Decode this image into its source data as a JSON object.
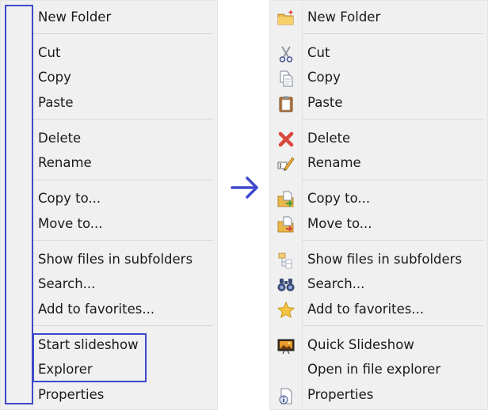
{
  "left_menu": {
    "items": [
      {
        "label": "New Folder"
      },
      {
        "label": "Cut"
      },
      {
        "label": "Copy"
      },
      {
        "label": "Paste"
      },
      {
        "label": "Delete"
      },
      {
        "label": "Rename"
      },
      {
        "label": "Copy to..."
      },
      {
        "label": "Move to..."
      },
      {
        "label": "Show files in subfolders"
      },
      {
        "label": "Search..."
      },
      {
        "label": "Add to favorites..."
      },
      {
        "label": "Start slideshow"
      },
      {
        "label": "Explorer"
      },
      {
        "label": "Properties"
      }
    ]
  },
  "right_menu": {
    "items": [
      {
        "label": "New Folder",
        "icon": "new-folder-icon"
      },
      {
        "label": "Cut",
        "icon": "scissors-icon"
      },
      {
        "label": "Copy",
        "icon": "copy-icon"
      },
      {
        "label": "Paste",
        "icon": "clipboard-icon"
      },
      {
        "label": "Delete",
        "icon": "delete-x-icon"
      },
      {
        "label": "Rename",
        "icon": "rename-pencil-icon"
      },
      {
        "label": "Copy to...",
        "icon": "copy-to-folder-icon"
      },
      {
        "label": "Move to...",
        "icon": "move-to-folder-icon"
      },
      {
        "label": "Show files in subfolders",
        "icon": "subfolder-files-icon"
      },
      {
        "label": "Search...",
        "icon": "binoculars-icon"
      },
      {
        "label": "Add to favorites...",
        "icon": "star-icon"
      },
      {
        "label": "Quick Slideshow",
        "icon": "slideshow-icon"
      },
      {
        "label": "Open in file explorer",
        "icon": ""
      },
      {
        "label": "Properties",
        "icon": "properties-icon"
      }
    ]
  },
  "colors": {
    "highlight_border": "#3f48cc",
    "arrow": "#3f48cc",
    "menu_background": "#f0f0f0"
  }
}
